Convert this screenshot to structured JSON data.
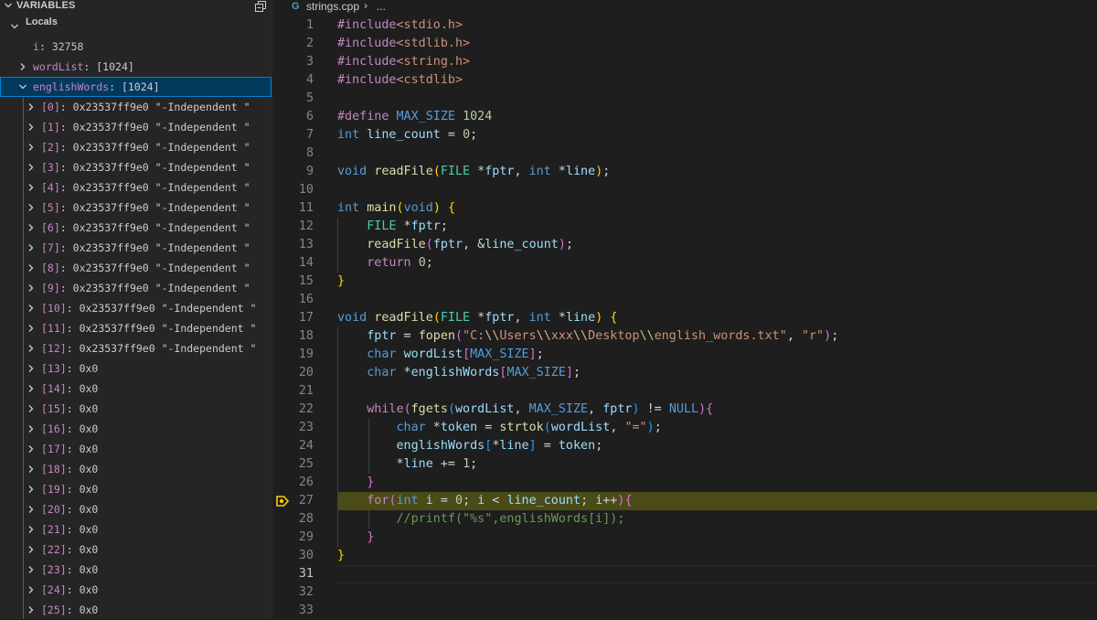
{
  "variables_panel": {
    "title": "VARIABLES",
    "scope": "Locals",
    "vars": [
      {
        "name": "i",
        "value": "32758",
        "kind": "num"
      },
      {
        "name": "wordList",
        "value": "[1024]",
        "kind": "gray"
      },
      {
        "name": "englishWords",
        "value": "[1024]",
        "kind": "gray"
      }
    ],
    "elements": [
      {
        "index": "[0]",
        "value": "0x23537ff9e0 \"-Independent \""
      },
      {
        "index": "[1]",
        "value": "0x23537ff9e0 \"-Independent \""
      },
      {
        "index": "[2]",
        "value": "0x23537ff9e0 \"-Independent \""
      },
      {
        "index": "[3]",
        "value": "0x23537ff9e0 \"-Independent \""
      },
      {
        "index": "[4]",
        "value": "0x23537ff9e0 \"-Independent \""
      },
      {
        "index": "[5]",
        "value": "0x23537ff9e0 \"-Independent \""
      },
      {
        "index": "[6]",
        "value": "0x23537ff9e0 \"-Independent \""
      },
      {
        "index": "[7]",
        "value": "0x23537ff9e0 \"-Independent \""
      },
      {
        "index": "[8]",
        "value": "0x23537ff9e0 \"-Independent \""
      },
      {
        "index": "[9]",
        "value": "0x23537ff9e0 \"-Independent \""
      },
      {
        "index": "[10]",
        "value": "0x23537ff9e0 \"-Independent \""
      },
      {
        "index": "[11]",
        "value": "0x23537ff9e0 \"-Independent \""
      },
      {
        "index": "[12]",
        "value": "0x23537ff9e0 \"-Independent \""
      },
      {
        "index": "[13]",
        "value": "0x0"
      },
      {
        "index": "[14]",
        "value": "0x0"
      },
      {
        "index": "[15]",
        "value": "0x0"
      },
      {
        "index": "[16]",
        "value": "0x0"
      },
      {
        "index": "[17]",
        "value": "0x0"
      },
      {
        "index": "[18]",
        "value": "0x0"
      },
      {
        "index": "[19]",
        "value": "0x0"
      },
      {
        "index": "[20]",
        "value": "0x0"
      },
      {
        "index": "[21]",
        "value": "0x0"
      },
      {
        "index": "[22]",
        "value": "0x0"
      },
      {
        "index": "[23]",
        "value": "0x0"
      },
      {
        "index": "[24]",
        "value": "0x0"
      },
      {
        "index": "[25]",
        "value": "0x0"
      }
    ]
  },
  "breadcrumb": {
    "file": "strings.cpp",
    "separator": "›",
    "more": "..."
  },
  "editor": {
    "current_line": 27,
    "cursor_line": 31,
    "lines": [
      {
        "n": "1",
        "tokens": [
          [
            "pp",
            "#include"
          ],
          [
            "inc",
            "<stdio.h>"
          ]
        ]
      },
      {
        "n": "2",
        "tokens": [
          [
            "pp",
            "#include"
          ],
          [
            "inc",
            "<stdlib.h>"
          ]
        ]
      },
      {
        "n": "3",
        "tokens": [
          [
            "pp",
            "#include"
          ],
          [
            "inc",
            "<string.h>"
          ]
        ]
      },
      {
        "n": "4",
        "tokens": [
          [
            "pp",
            "#include"
          ],
          [
            "inc",
            "<cstdlib>"
          ]
        ]
      },
      {
        "n": "5",
        "tokens": []
      },
      {
        "n": "6",
        "tokens": [
          [
            "pp",
            "#define"
          ],
          [
            "op",
            " "
          ],
          [
            "mac",
            "MAX_SIZE"
          ],
          [
            "op",
            " "
          ],
          [
            "num",
            "1024"
          ]
        ]
      },
      {
        "n": "7",
        "tokens": [
          [
            "kw",
            "int"
          ],
          [
            "op",
            " "
          ],
          [
            "var",
            "line_count"
          ],
          [
            "op",
            " = "
          ],
          [
            "num",
            "0"
          ],
          [
            "op",
            ";"
          ]
        ]
      },
      {
        "n": "8",
        "tokens": []
      },
      {
        "n": "9",
        "tokens": [
          [
            "kw",
            "void"
          ],
          [
            "op",
            " "
          ],
          [
            "fn",
            "readFile"
          ],
          [
            "b1",
            "("
          ],
          [
            "ty",
            "FILE"
          ],
          [
            "op",
            " *"
          ],
          [
            "var",
            "fptr"
          ],
          [
            "op",
            ", "
          ],
          [
            "kw",
            "int"
          ],
          [
            "op",
            " *"
          ],
          [
            "var",
            "line"
          ],
          [
            "b1",
            ")"
          ],
          [
            "op",
            ";"
          ]
        ]
      },
      {
        "n": "10",
        "tokens": []
      },
      {
        "n": "11",
        "tokens": [
          [
            "kw",
            "int"
          ],
          [
            "op",
            " "
          ],
          [
            "fn",
            "main"
          ],
          [
            "b1",
            "("
          ],
          [
            "kw",
            "void"
          ],
          [
            "b1",
            ")"
          ],
          [
            "op",
            " "
          ],
          [
            "b1",
            "{"
          ]
        ]
      },
      {
        "n": "12",
        "tokens": [
          [
            "op",
            "    "
          ],
          [
            "ty",
            "FILE"
          ],
          [
            "op",
            " *"
          ],
          [
            "var",
            "fptr"
          ],
          [
            "op",
            ";"
          ]
        ]
      },
      {
        "n": "13",
        "tokens": [
          [
            "op",
            "    "
          ],
          [
            "fn",
            "readFile"
          ],
          [
            "b2",
            "("
          ],
          [
            "var",
            "fptr"
          ],
          [
            "op",
            ", &"
          ],
          [
            "var",
            "line_count"
          ],
          [
            "b2",
            ")"
          ],
          [
            "op",
            ";"
          ]
        ]
      },
      {
        "n": "14",
        "tokens": [
          [
            "op",
            "    "
          ],
          [
            "ctl",
            "return"
          ],
          [
            "op",
            " "
          ],
          [
            "num",
            "0"
          ],
          [
            "op",
            ";"
          ]
        ]
      },
      {
        "n": "15",
        "tokens": [
          [
            "b1",
            "}"
          ]
        ]
      },
      {
        "n": "16",
        "tokens": []
      },
      {
        "n": "17",
        "tokens": [
          [
            "kw",
            "void"
          ],
          [
            "op",
            " "
          ],
          [
            "fn",
            "readFile"
          ],
          [
            "b1",
            "("
          ],
          [
            "ty",
            "FILE"
          ],
          [
            "op",
            " *"
          ],
          [
            "var",
            "fptr"
          ],
          [
            "op",
            ", "
          ],
          [
            "kw",
            "int"
          ],
          [
            "op",
            " *"
          ],
          [
            "var",
            "line"
          ],
          [
            "b1",
            ")"
          ],
          [
            "op",
            " "
          ],
          [
            "b1",
            "{"
          ]
        ]
      },
      {
        "n": "18",
        "tokens": [
          [
            "op",
            "    "
          ],
          [
            "var",
            "fptr"
          ],
          [
            "op",
            " = "
          ],
          [
            "fn",
            "fopen"
          ],
          [
            "b2",
            "("
          ],
          [
            "str",
            "\"C:"
          ],
          [
            "esc",
            "\\\\"
          ],
          [
            "str",
            "Users"
          ],
          [
            "esc",
            "\\\\"
          ],
          [
            "str",
            "xxx"
          ],
          [
            "esc",
            "\\\\"
          ],
          [
            "str",
            "Desktop"
          ],
          [
            "esc",
            "\\\\"
          ],
          [
            "str",
            "english_words.txt\""
          ],
          [
            "op",
            ", "
          ],
          [
            "str",
            "\"r\""
          ],
          [
            "b2",
            ")"
          ],
          [
            "op",
            ";"
          ]
        ]
      },
      {
        "n": "19",
        "tokens": [
          [
            "op",
            "    "
          ],
          [
            "kw",
            "char"
          ],
          [
            "op",
            " "
          ],
          [
            "var",
            "wordList"
          ],
          [
            "b2",
            "["
          ],
          [
            "mac",
            "MAX_SIZE"
          ],
          [
            "b2",
            "]"
          ],
          [
            "op",
            ";"
          ]
        ]
      },
      {
        "n": "20",
        "tokens": [
          [
            "op",
            "    "
          ],
          [
            "kw",
            "char"
          ],
          [
            "op",
            " *"
          ],
          [
            "var",
            "englishWords"
          ],
          [
            "b2",
            "["
          ],
          [
            "mac",
            "MAX_SIZE"
          ],
          [
            "b2",
            "]"
          ],
          [
            "op",
            ";"
          ]
        ]
      },
      {
        "n": "21",
        "tokens": []
      },
      {
        "n": "22",
        "tokens": [
          [
            "op",
            "    "
          ],
          [
            "ctl",
            "while"
          ],
          [
            "b2",
            "("
          ],
          [
            "fn",
            "fgets"
          ],
          [
            "b3",
            "("
          ],
          [
            "var",
            "wordList"
          ],
          [
            "op",
            ", "
          ],
          [
            "mac",
            "MAX_SIZE"
          ],
          [
            "op",
            ", "
          ],
          [
            "var",
            "fptr"
          ],
          [
            "b3",
            ")"
          ],
          [
            "op",
            " != "
          ],
          [
            "mac",
            "NULL"
          ],
          [
            "b2",
            ")"
          ],
          [
            "b2",
            "{"
          ]
        ]
      },
      {
        "n": "23",
        "tokens": [
          [
            "op",
            "        "
          ],
          [
            "kw",
            "char"
          ],
          [
            "op",
            " *"
          ],
          [
            "var",
            "token"
          ],
          [
            "op",
            " = "
          ],
          [
            "fn",
            "strtok"
          ],
          [
            "b3",
            "("
          ],
          [
            "var",
            "wordList"
          ],
          [
            "op",
            ", "
          ],
          [
            "str",
            "\"=\""
          ],
          [
            "b3",
            ")"
          ],
          [
            "op",
            ";"
          ]
        ]
      },
      {
        "n": "24",
        "tokens": [
          [
            "op",
            "        "
          ],
          [
            "var",
            "englishWords"
          ],
          [
            "b3",
            "["
          ],
          [
            "op",
            "*"
          ],
          [
            "var",
            "line"
          ],
          [
            "b3",
            "]"
          ],
          [
            "op",
            " = "
          ],
          [
            "var",
            "token"
          ],
          [
            "op",
            ";"
          ]
        ]
      },
      {
        "n": "25",
        "tokens": [
          [
            "op",
            "        *"
          ],
          [
            "var",
            "line"
          ],
          [
            "op",
            " += "
          ],
          [
            "num",
            "1"
          ],
          [
            "op",
            ";"
          ]
        ]
      },
      {
        "n": "26",
        "tokens": [
          [
            "op",
            "    "
          ],
          [
            "b2",
            "}"
          ]
        ]
      },
      {
        "n": "27",
        "tokens": [
          [
            "op",
            "    "
          ],
          [
            "ctl",
            "for"
          ],
          [
            "b2",
            "("
          ],
          [
            "kw",
            "int"
          ],
          [
            "op",
            " "
          ],
          [
            "var",
            "i"
          ],
          [
            "op",
            " = "
          ],
          [
            "num",
            "0"
          ],
          [
            "op",
            "; "
          ],
          [
            "var",
            "i"
          ],
          [
            "op",
            " < "
          ],
          [
            "var",
            "line_count"
          ],
          [
            "op",
            "; "
          ],
          [
            "var",
            "i"
          ],
          [
            "op",
            "++"
          ],
          [
            "b2",
            ")"
          ],
          [
            "b2",
            "{"
          ]
        ]
      },
      {
        "n": "28",
        "tokens": [
          [
            "op",
            "        "
          ],
          [
            "cm",
            "//printf(\"%s\",englishWords[i]);"
          ]
        ]
      },
      {
        "n": "29",
        "tokens": [
          [
            "op",
            "    "
          ],
          [
            "b2",
            "}"
          ]
        ]
      },
      {
        "n": "30",
        "tokens": [
          [
            "b1",
            "}"
          ]
        ]
      },
      {
        "n": "31",
        "tokens": []
      },
      {
        "n": "32",
        "tokens": []
      },
      {
        "n": "33",
        "tokens": []
      }
    ]
  }
}
